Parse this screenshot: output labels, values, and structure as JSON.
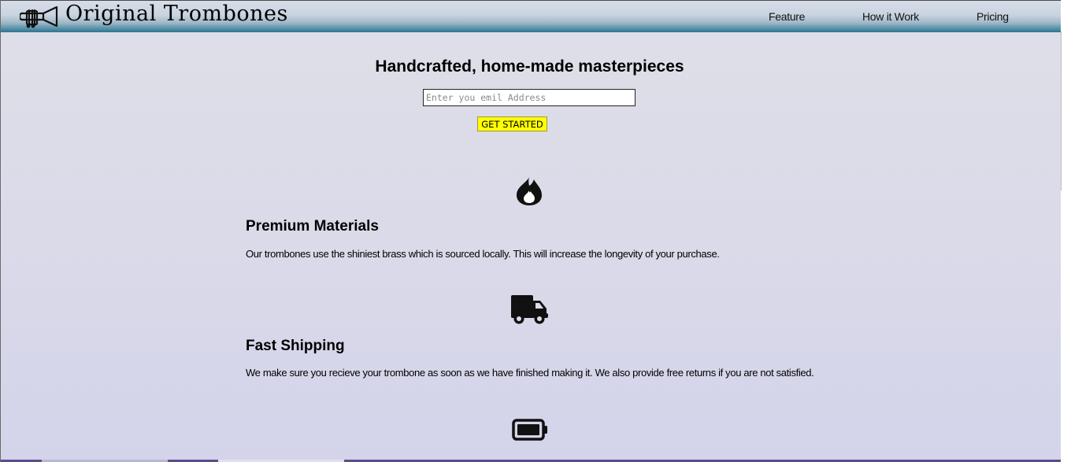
{
  "header": {
    "logo_text": "Original Trombones",
    "logo_icon": "trombone-icon",
    "nav": [
      {
        "label": "Feature"
      },
      {
        "label": "How it Work"
      },
      {
        "label": "Pricing"
      }
    ]
  },
  "hero": {
    "title": "Handcrafted, home-made masterpieces",
    "email_placeholder": "Enter you emil Address",
    "cta_label": "GET STARTED"
  },
  "features": [
    {
      "icon": "fire-icon",
      "title": "Premium Materials",
      "description": "Our trombones use the shiniest brass which is sourced locally. This will increase the longevity of your purchase."
    },
    {
      "icon": "truck-icon",
      "title": "Fast Shipping",
      "description": "We make sure you recieve your trombone as soon as we have finished making it. We also provide free returns if you are not satisfied."
    },
    {
      "icon": "battery-full-icon"
    }
  ],
  "colors": {
    "cta_background": "#ffff00",
    "header_accent": "#2f7390",
    "page_background": "#dcdce9"
  }
}
